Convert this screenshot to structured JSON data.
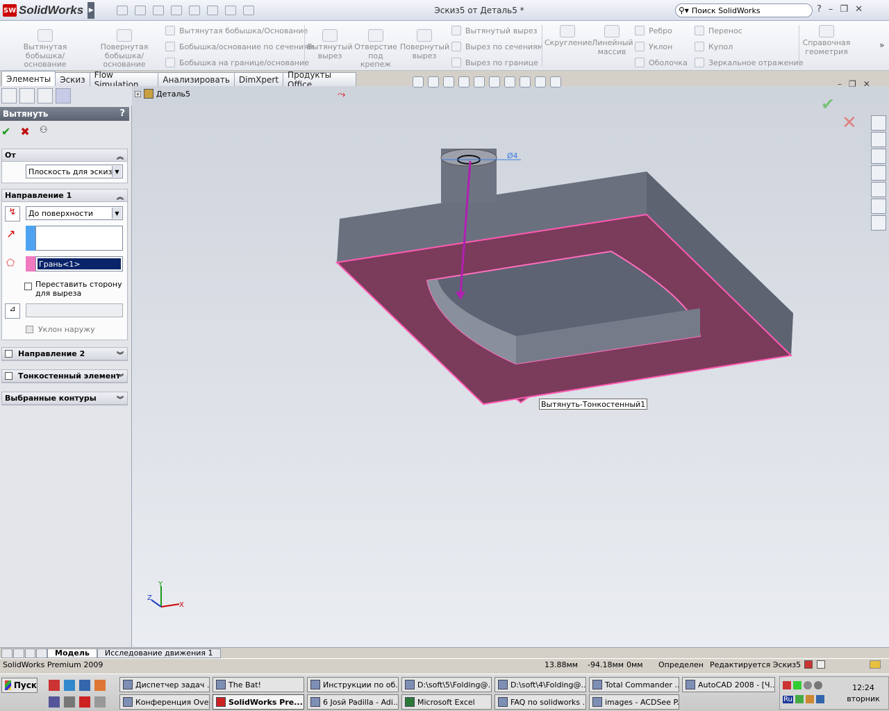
{
  "app": {
    "name": "SolidWorks",
    "doc_title": "Эскиз5 от Деталь5 *",
    "search_placeholder": "Поиск SolidWorks"
  },
  "ribbon": {
    "extruded_boss": "Вытянутая бобышка/основание",
    "revolved_boss": "Повернутая бобышка/основание",
    "swept_boss": "Вытянутая бобышка/Основание",
    "lofted_boss": "Бобышка/основание по сечениям",
    "boundary_boss": "Бобышка на границе/основание",
    "extruded_cut": "Вытянутый вырез",
    "hole_wizard": "Отверстие под крепеж",
    "revolved_cut": "Повернутый вырез",
    "swept_cut": "Вытянутый вырез",
    "lofted_cut": "Вырез по сечениям",
    "boundary_cut": "Вырез по границе",
    "fillet": "Скругление",
    "linear_pattern": "Линейный массив",
    "rib": "Ребро",
    "draft": "Уклон",
    "shell": "Оболочка",
    "wrap": "Перенос",
    "dome": "Купол",
    "mirror": "Зеркальное отражение",
    "ref_geometry": "Справочная геометрия"
  },
  "tabs": [
    "Элементы",
    "Эскиз",
    "Flow Simulation",
    "Анализировать",
    "DimXpert",
    "Продукты Office"
  ],
  "property_manager": {
    "title": "Вытянуть",
    "help": "?",
    "from_label": "От",
    "from_value": "Плоскость для эскиза",
    "dir1_label": "Направление 1",
    "dir1_end": "До поверхности",
    "face_value": "Грань<1>",
    "flip_label": "Переставить сторону для выреза",
    "draft_outward": "Уклон наружу",
    "dir2_label": "Направление 2",
    "thin_label": "Тонкостенный элемент",
    "contours_label": "Выбранные контуры"
  },
  "tree": {
    "root": "Деталь5"
  },
  "viewport": {
    "tooltip": "Вытянуть-Тонкостенный1",
    "dim_label": "Ø4",
    "axis_x": "X",
    "axis_y": "Y",
    "axis_z": "Z"
  },
  "bottom_tabs": [
    "Модель",
    "Исследование движения 1"
  ],
  "status": {
    "product": "SolidWorks Premium 2009",
    "x": "13.88мм",
    "y": "-94.18мм",
    "z": "0мм",
    "state": "Определен",
    "editing": "Редактируется Эскиз5"
  },
  "taskbar": {
    "start": "Пуск",
    "row1": [
      "Диспетчер задач ...",
      "The Bat!",
      "Инструкции по об...",
      "D:\\soft\\5\\Folding@...",
      "D:\\soft\\4\\Folding@...",
      "Total Commander ...",
      "AutoCAD 2008 - [Ч..."
    ],
    "row2": [
      "Конференция Ove...",
      "SolidWorks Pre...",
      "6 Josй Padilla - Adi...",
      "Microsoft Excel",
      "FAQ по solidworks ...",
      "images - ACDSee P..."
    ],
    "lang": "Ru",
    "time": "12:24",
    "day": "вторник"
  }
}
